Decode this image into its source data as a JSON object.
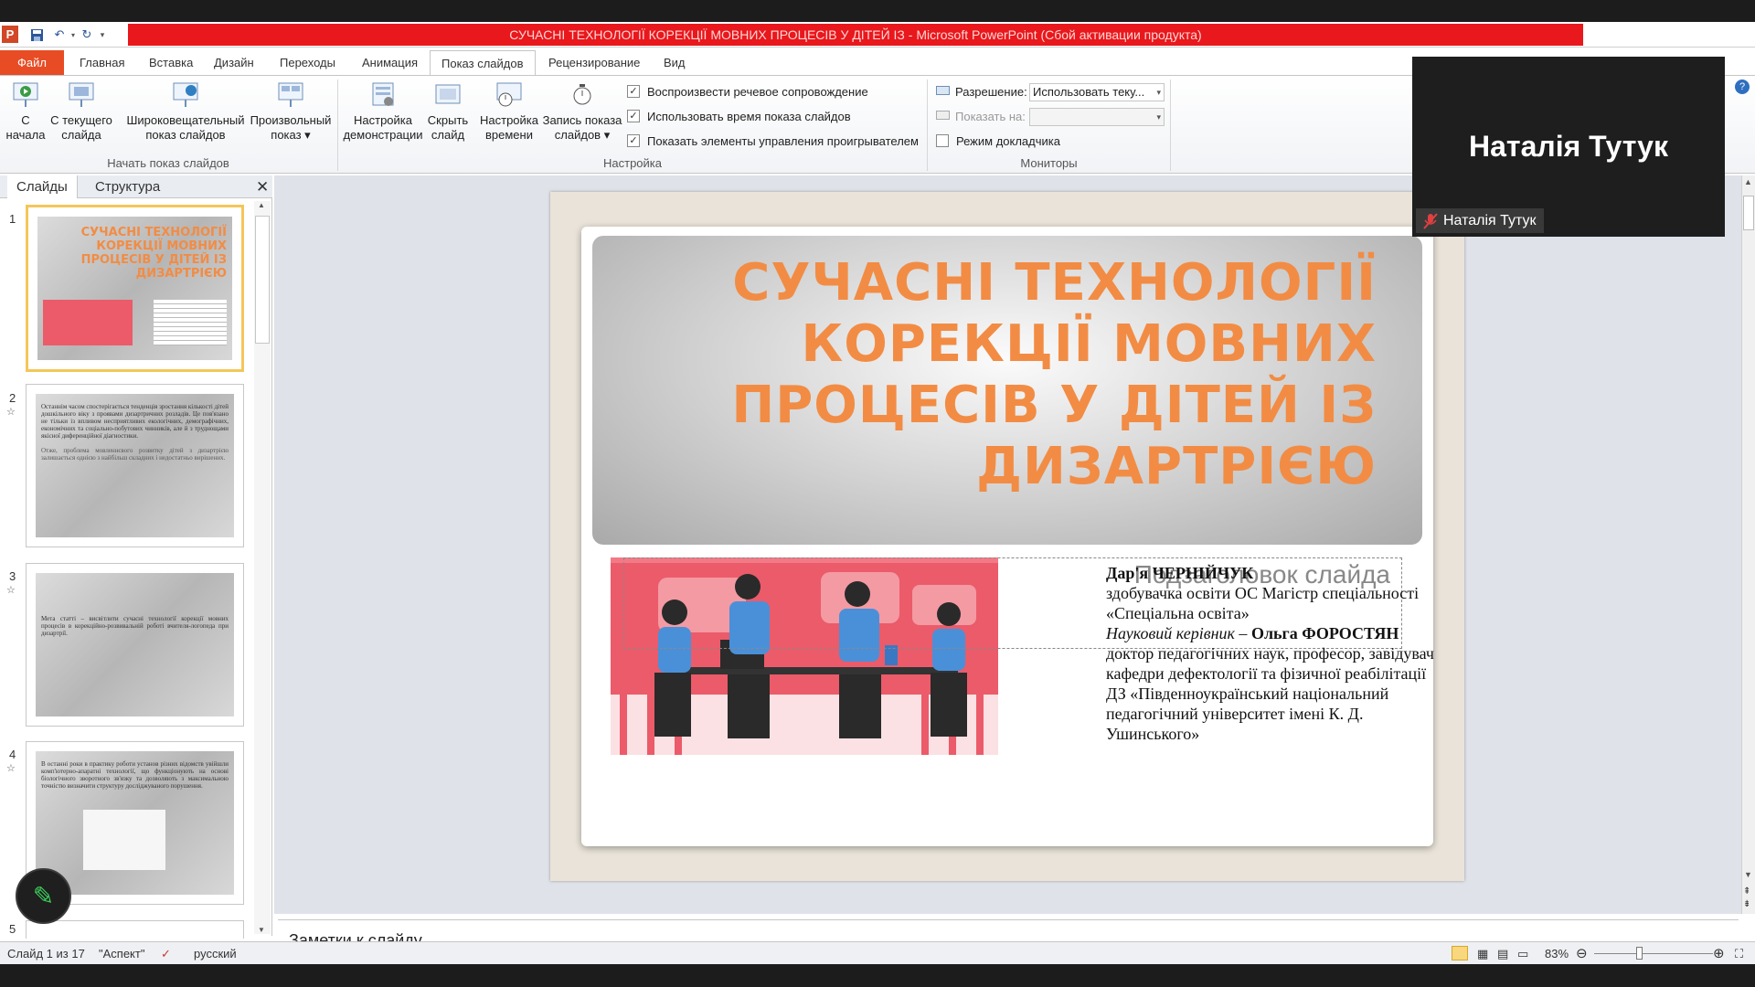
{
  "window": {
    "title": "СУЧАСНІ ТЕХНОЛОГІЇ КОРЕКЦІЇ МОВНИХ ПРОЦЕСІВ У ДІТЕЙ ІЗ  - Microsoft PowerPoint (Сбой активации продукта)",
    "logo": "P"
  },
  "tabs": {
    "file": "Файл",
    "home": "Главная",
    "insert": "Вставка",
    "design": "Дизайн",
    "transitions": "Переходы",
    "animation": "Анимация",
    "slideshow": "Показ слайдов",
    "review": "Рецензирование",
    "view": "Вид"
  },
  "ribbon": {
    "from_start": [
      "С",
      "начала"
    ],
    "from_current": [
      "С текущего",
      "слайда"
    ],
    "broadcast": [
      "Широковещательный",
      "показ слайдов"
    ],
    "custom": [
      "Произвольный",
      "показ ▾"
    ],
    "setup": [
      "Настройка",
      "демонстрации"
    ],
    "hide": [
      "Скрыть",
      "слайд"
    ],
    "timing": [
      "Настройка",
      "времени"
    ],
    "record": [
      "Запись показа",
      "слайдов ▾"
    ],
    "group_start": "Начать показ слайдов",
    "group_setup": "Настройка",
    "group_monitors": "Мониторы",
    "chk_narration": "Воспроизвести речевое сопровождение",
    "chk_timings": "Использовать время показа слайдов",
    "chk_controls": "Показать элементы управления проигрывателем",
    "chk_presenter": "Режим докладчика",
    "resolution_label": "Разрешение:",
    "resolution_value": "Использовать теку...",
    "showon_label": "Показать на:",
    "showon_value": ""
  },
  "pane": {
    "tab_slides": "Слайды",
    "tab_outline": "Структура",
    "close": "✕"
  },
  "thumbs": {
    "t1_title": "СУЧАСНІ ТЕХНОЛОГІЇ КОРЕКЦІЇ МОВНИХ ПРОЦЕСІВ У ДІТЕЙ ІЗ ДИЗАРТРІЄЮ",
    "t2_p1": "Останнім часом спостерігається тенденція зростання кількості дітей дошкільного віку з проявами дизартричних розладів. Це пов'язано не тільки із впливом несприятливих екологічних, демографічних, економічних та соціально-побутових чинників, але й з труднощами якісної диференційної діагностики.",
    "t2_p2": "Отже, проблема мовленнєвого розвитку дітей з дизартрією залишається однією з найбільш складних і недостатньо вирішених.",
    "t3_text": "Мета статті – висвітлити сучасні технології корекції мовних процесів в корекційно-розвивальній роботі вчителя-логопеда при дизартрії.",
    "t4_text": "В останні роки в практику роботи установ різних відомств увійшли комп'ютерно-апаратні технології, що функціонують на основі біологічного зворотного зв'язку та дозволяють з максимальною точністю визначити структуру досліджуваного порушення."
  },
  "slide": {
    "title": "СУЧАСНІ ТЕХНОЛОГІЇ КОРЕКЦІЇ МОВНИХ ПРОЦЕСІВ У ДІТЕЙ ІЗ ДИЗАРТРІЄЮ",
    "subtitle_placeholder": "Подзаголовок слайда",
    "author_name": "Дар'я ЧЕРНІЙЧУК",
    "author_role": "здобувачка освіти ОС Магістр спеціальності «Спеціальна освіта»",
    "supervisor_label": "Науковий керівник – ",
    "supervisor_name": "Ольга ФОРОСТЯН",
    "supervisor_info": "доктор педагогічних наук, професор, завідувач кафедри дефектології та фізичної реабілітації ДЗ «Південноукраїнський національний педагогічний університет імені К. Д. Ушинського»"
  },
  "notes": {
    "placeholder": "Заметки к слайду"
  },
  "status": {
    "slide": "Слайд 1 из 17",
    "theme": "\"Аспект\"",
    "lang": "русский",
    "zoom": "83%"
  },
  "video": {
    "name": "Наталія Тутук",
    "tag": "Наталія Тутук"
  },
  "colors": {
    "accent": "#f28c44",
    "title_bar": "#e8181c",
    "file_tab": "#e74c25"
  }
}
